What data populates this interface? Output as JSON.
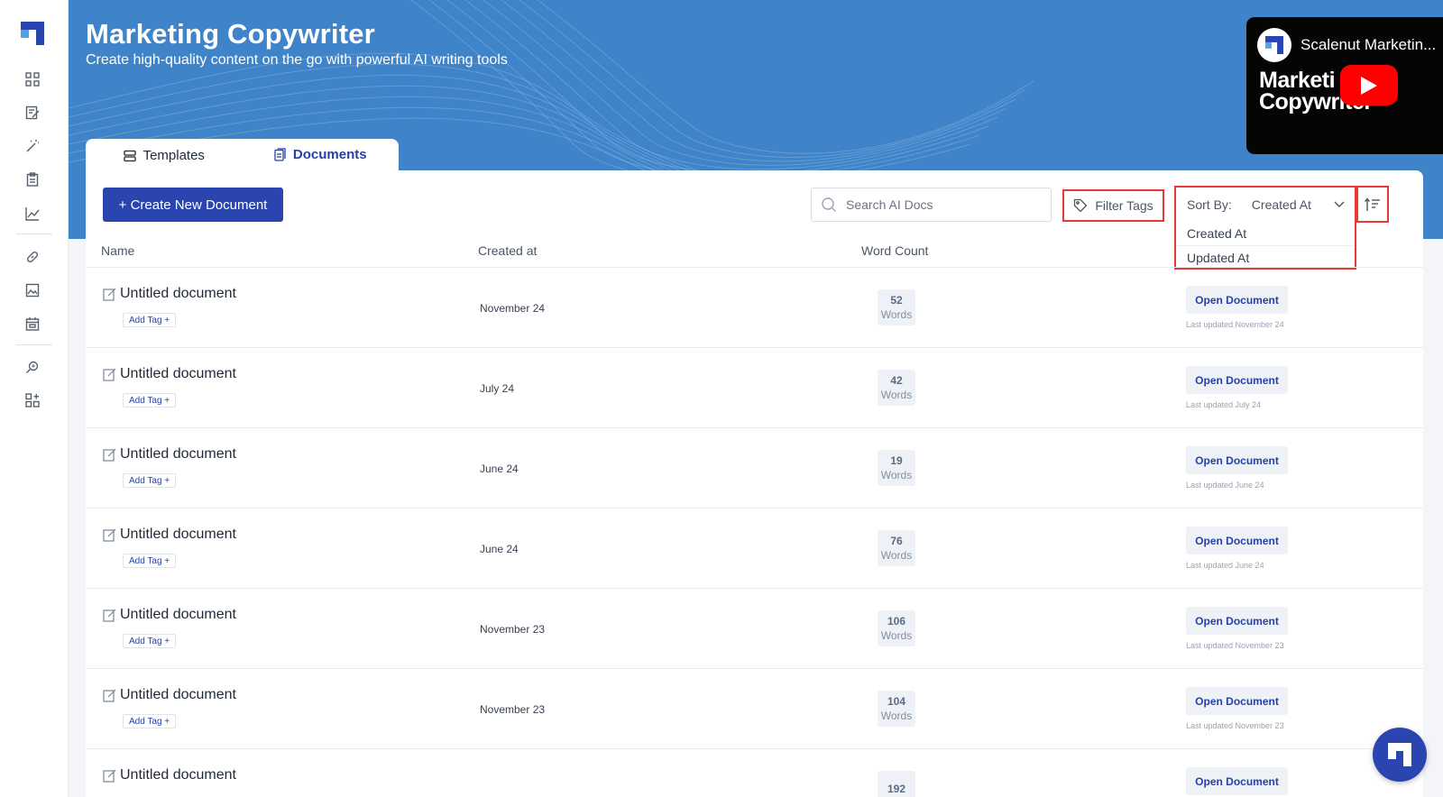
{
  "colors": {
    "brand": "#2a45b0",
    "hero": "#3f84c8",
    "highlight": "#e53935"
  },
  "sidebar": {
    "icons": [
      "grid-icon",
      "edit-doc-icon",
      "magic-wand-icon",
      "clipboard-icon",
      "chart-line-icon",
      "link-icon",
      "image-icon",
      "calendar-icon",
      "search-sparkle-icon",
      "apps-add-icon"
    ]
  },
  "header": {
    "title": "Marketing Copywriter",
    "subtitle": "Create high-quality content on the go with powerful AI writing tools"
  },
  "video": {
    "channel_title": "Scalenut Marketin...",
    "thumbnail_line1": "Marketi",
    "thumbnail_line2": "Copywriter"
  },
  "tabs": [
    {
      "label": "Templates",
      "icon": "stack-icon",
      "active": false
    },
    {
      "label": "Documents",
      "icon": "document-icon",
      "active": true
    }
  ],
  "toolbar": {
    "create_label": "+ Create New Document",
    "search_placeholder": "Search AI Docs",
    "filter_label": "Filter Tags",
    "sort_label": "Sort By:",
    "sort_value": "Created At",
    "sort_options": [
      "Created At",
      "Updated At"
    ]
  },
  "table": {
    "headers": {
      "name": "Name",
      "created": "Created at",
      "word_count": "Word Count"
    },
    "rows": [
      {
        "name": "Untitled document",
        "tag": "Add Tag +",
        "created": "November 24",
        "words": "52",
        "words_label": "Words",
        "action": "Open Document",
        "updated": "Last updated November 24"
      },
      {
        "name": "Untitled document",
        "tag": "Add Tag +",
        "created": "July 24",
        "words": "42",
        "words_label": "Words",
        "action": "Open Document",
        "updated": "Last updated July 24"
      },
      {
        "name": "Untitled document",
        "tag": "Add Tag +",
        "created": "June 24",
        "words": "19",
        "words_label": "Words",
        "action": "Open Document",
        "updated": "Last updated June 24"
      },
      {
        "name": "Untitled document",
        "tag": "Add Tag +",
        "created": "June 24",
        "words": "76",
        "words_label": "Words",
        "action": "Open Document",
        "updated": "Last updated June 24"
      },
      {
        "name": "Untitled document",
        "tag": "Add Tag +",
        "created": "November 23",
        "words": "106",
        "words_label": "Words",
        "action": "Open Document",
        "updated": "Last updated November 23"
      },
      {
        "name": "Untitled document",
        "tag": "Add Tag +",
        "created": "November 23",
        "words": "104",
        "words_label": "Words",
        "action": "Open Document",
        "updated": "Last updated November 23"
      },
      {
        "name": "Untitled document",
        "tag": "",
        "created": "",
        "words": "192",
        "words_label": "",
        "action": "Open Document",
        "updated": ""
      }
    ]
  }
}
